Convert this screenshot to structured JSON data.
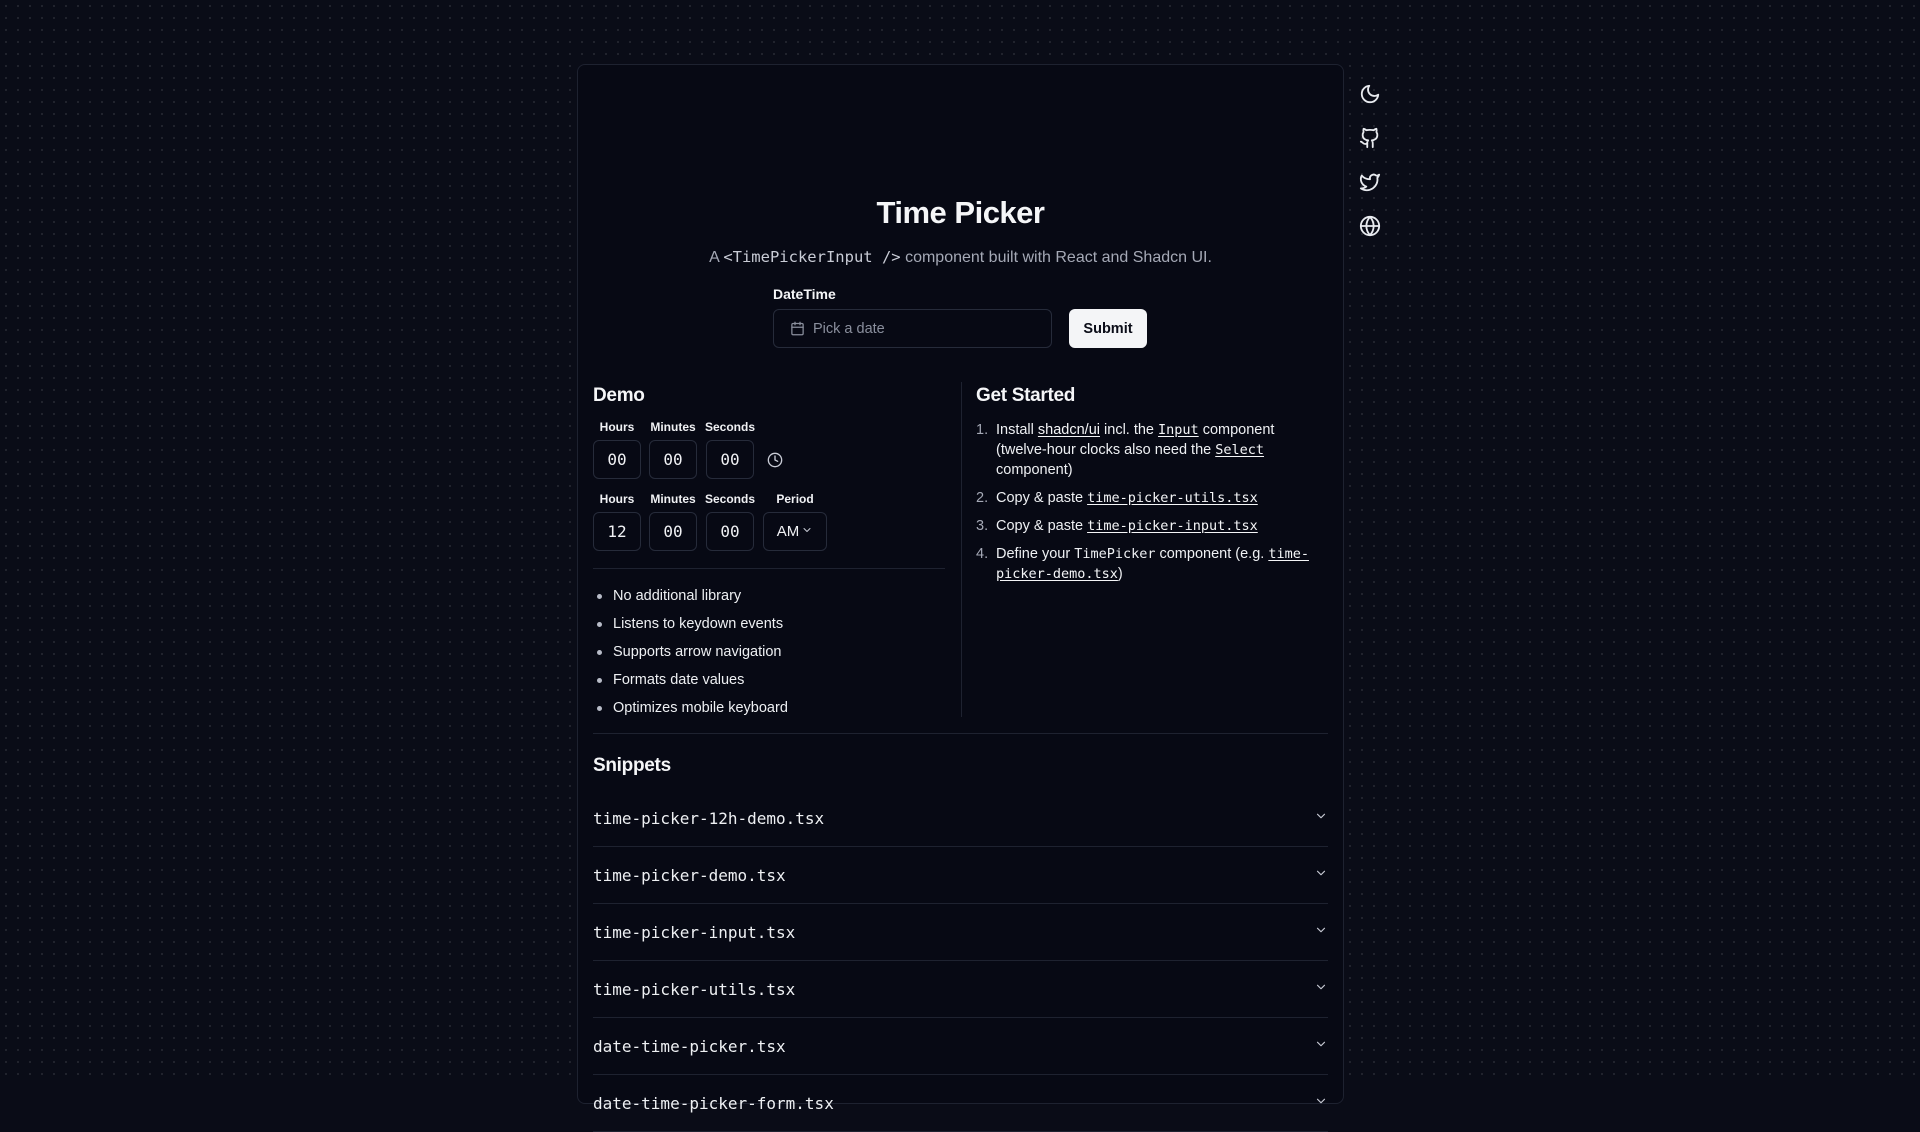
{
  "header": {
    "title": "Time Picker",
    "subtitle_prefix": "A ",
    "subtitle_code": "<TimePickerInput />",
    "subtitle_suffix": " component built with React and Shadcn UI."
  },
  "datetime_form": {
    "label": "DateTime",
    "placeholder": "Pick a date",
    "submit_label": "Submit"
  },
  "demo": {
    "title": "Demo",
    "picker_24h": {
      "hours_label": "Hours",
      "hours_value": "00",
      "minutes_label": "Minutes",
      "minutes_value": "00",
      "seconds_label": "Seconds",
      "seconds_value": "00"
    },
    "picker_12h": {
      "hours_label": "Hours",
      "hours_value": "12",
      "minutes_label": "Minutes",
      "minutes_value": "00",
      "seconds_label": "Seconds",
      "seconds_value": "00",
      "period_label": "Period",
      "period_value": "AM"
    },
    "features": [
      "No additional library",
      "Listens to keydown events",
      "Supports arrow navigation",
      "Formats date values",
      "Optimizes mobile keyboard"
    ]
  },
  "get_started": {
    "title": "Get Started",
    "step1": {
      "num": "1.",
      "t1": "Install ",
      "link1": "shadcn/ui",
      "t2": " incl. the ",
      "code1": "Input",
      "t3": " component (twelve-hour clocks also need the ",
      "code2": "Select",
      "t4": " component)"
    },
    "step2": {
      "num": "2.",
      "t1": "Copy & paste ",
      "code": "time-picker-utils.tsx"
    },
    "step3": {
      "num": "3.",
      "t1": "Copy & paste ",
      "code": "time-picker-input.tsx"
    },
    "step4": {
      "num": "4.",
      "t1": "Define your ",
      "code1": "TimePicker",
      "t2": " component (e.g. ",
      "code2": "time-picker-demo.tsx",
      "t3": ")"
    }
  },
  "snippets": {
    "title": "Snippets",
    "items": [
      "time-picker-12h-demo.tsx",
      "time-picker-demo.tsx",
      "time-picker-input.tsx",
      "time-picker-utils.tsx",
      "date-time-picker.tsx",
      "date-time-picker-form.tsx"
    ]
  },
  "side_icons": [
    "moon-icon",
    "github-icon",
    "twitter-icon",
    "globe-icon"
  ],
  "colors": {
    "background": "#0a0c17",
    "card": "#070914",
    "border": "#1e2230",
    "text": "#f5f6f8",
    "muted": "#a5a9b6",
    "button_bg": "#f4f5f7"
  }
}
